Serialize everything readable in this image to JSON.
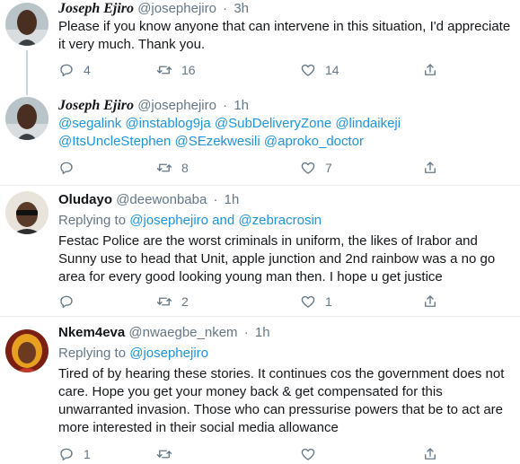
{
  "tweets": [
    {
      "name": "Joseph Ejiro",
      "handle": "@josephejiro",
      "separator": "·",
      "time": "3h",
      "reply_to": "",
      "text": "Please if you know anyone that can intervene in this situation, I'd appreciate it very much. Thank you.",
      "replies": "4",
      "retweets": "16",
      "likes": "14"
    },
    {
      "name": "Joseph Ejiro",
      "handle": "@josephejiro",
      "separator": "·",
      "time": "1h",
      "reply_to": "",
      "text": "@segalink @instablog9ja @SubDeliveryZone @lindaikeji @ItsUncleStephen @SEzekwesili @aproko_doctor",
      "replies": "",
      "retweets": "8",
      "likes": "7"
    },
    {
      "name": "Oludayo",
      "handle": "@deewonbaba",
      "separator": "·",
      "time": "1h",
      "reply_to_prefix": "Replying to",
      "reply_to_mention_1": "@josephejiro",
      "reply_to_and": "and",
      "reply_to_mention_2": "@zebracrosin",
      "text": "Festac Police are the worst criminals in uniform, the likes of Irabor and Sunny use to head that Unit, apple junction and 2nd rainbow was a no go area for every good looking young man then. I hope u get justice",
      "replies": "",
      "retweets": "2",
      "likes": "1"
    },
    {
      "name": "Nkem4eva",
      "handle": "@nwaegbe_nkem",
      "separator": "·",
      "time": "1h",
      "reply_to_prefix": "Replying to",
      "reply_to_mention_1": "@josephejiro",
      "text": "Tired of by hearing these stories. It continues cos the government does not care. Hope you get your money back & get compensated for this unwarranted invasion. Those who can pressurise powers that be to act are more interested in their social media allowance",
      "replies": "1",
      "retweets": "",
      "likes": ""
    }
  ],
  "icons": {
    "reply": "reply-icon",
    "retweet": "retweet-icon",
    "like": "heart-icon",
    "share": "share-icon"
  },
  "colors": {
    "link": "#1b95e0",
    "secondary_text": "#657786",
    "divider": "#e6ecf0",
    "thread_line": "#ccd6dd"
  }
}
